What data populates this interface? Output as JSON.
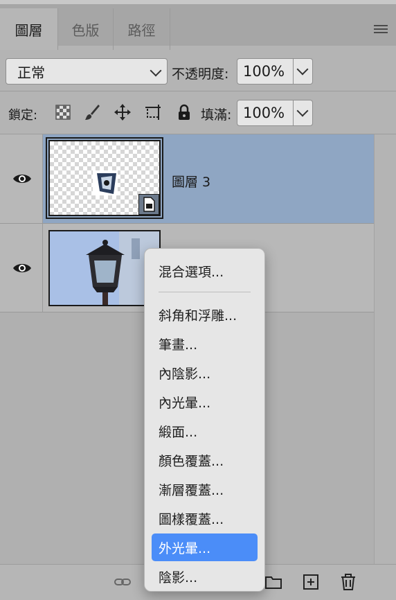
{
  "panel": {
    "tabs": [
      "圖層",
      "色版",
      "路徑"
    ],
    "active_tab": "圖層"
  },
  "blend": {
    "mode": "正常",
    "opacity_label": "不透明度:",
    "opacity": "100%"
  },
  "lock": {
    "label": "鎖定:",
    "fill_label": "填滿:",
    "fill": "100%"
  },
  "layers": [
    {
      "name": "圖層 3",
      "selected": true,
      "visible": true,
      "type": "smart-object"
    },
    {
      "name": "",
      "selected": false,
      "visible": true,
      "type": "photo"
    }
  ],
  "context_menu": {
    "items": [
      "混合選項...",
      "斜角和浮雕...",
      "筆畫...",
      "內陰影...",
      "內光暈...",
      "緞面...",
      "顏色覆蓋...",
      "漸層覆蓋...",
      "圖樣覆蓋...",
      "外光暈...",
      "陰影..."
    ],
    "highlighted": "外光暈..."
  },
  "colors": {
    "selected_layer": "#8fa6c3",
    "menu_highlight": "#4b8df8",
    "panel_bg": "#b4b4b4"
  }
}
